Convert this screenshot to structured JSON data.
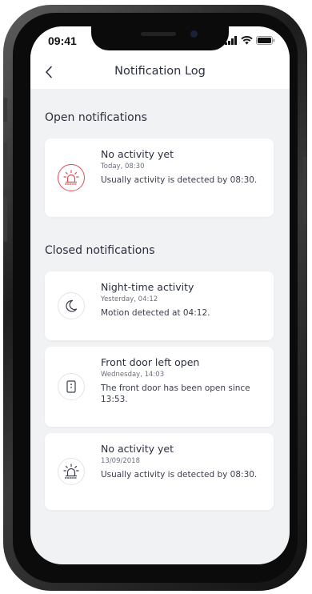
{
  "status_bar": {
    "time": "09:41",
    "icons": [
      "signal-icon",
      "wifi-icon",
      "battery-icon"
    ]
  },
  "nav": {
    "back_icon": "chevron-left-icon",
    "title": "Notification Log"
  },
  "sections": {
    "open_title": "Open notifications",
    "closed_title": "Closed notifications"
  },
  "open_notifications": [
    {
      "icon": "siren-icon",
      "title": "No activity yet",
      "time": "Today, 08:30",
      "message": "Usually activity is detected by 08:30."
    }
  ],
  "closed_notifications": [
    {
      "icon": "moon-icon",
      "title": "Night-time activity",
      "time": "Yesterday, 04:12",
      "message": "Motion detected at 04:12."
    },
    {
      "icon": "door-icon",
      "title": "Front door left open",
      "time": "Wednesday, 14:03",
      "message": "The front door has been open since 13:53."
    },
    {
      "icon": "siren-icon",
      "title": "No activity yet",
      "time": "13/09/2018",
      "message": "Usually activity is detected by 08:30."
    }
  ],
  "colors": {
    "alert": "#e04a55",
    "icon": "#3a3e4b",
    "background": "#f1f2f4",
    "card": "#ffffff"
  }
}
